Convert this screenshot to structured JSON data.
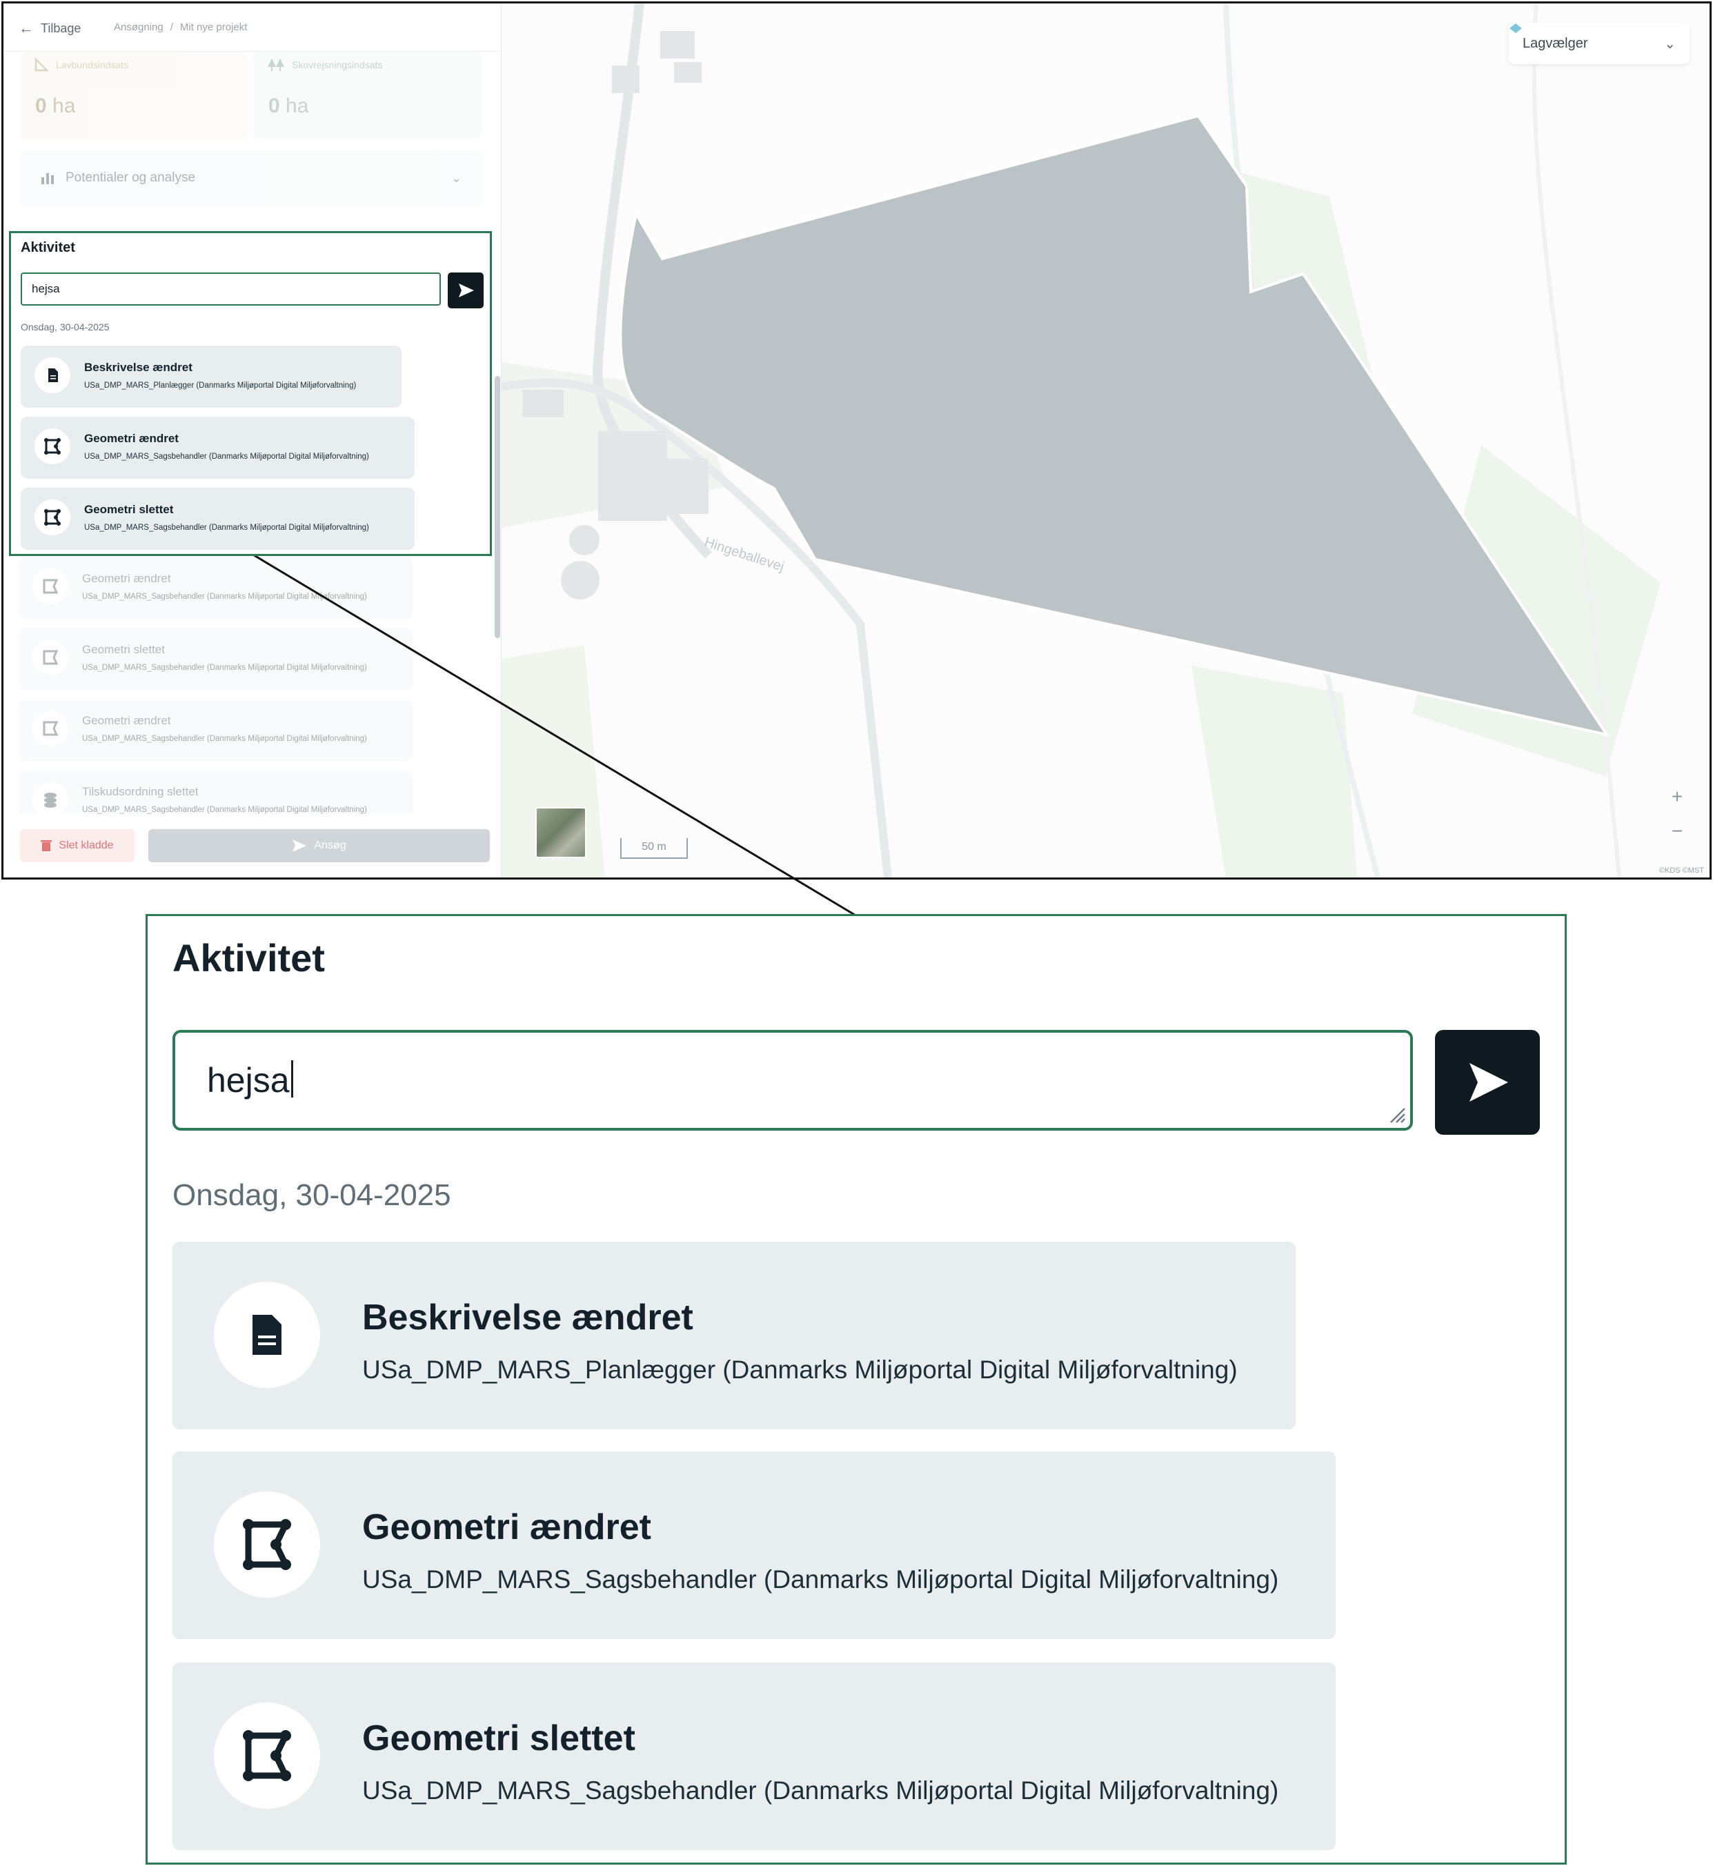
{
  "header": {
    "back_label": "Tilbage",
    "breadcrumb": [
      "Ansøgning",
      "/",
      "Mit nye projekt"
    ]
  },
  "stats": [
    {
      "label": "Lavbundsindsats",
      "value": "0",
      "unit": "ha",
      "icon": "ruler-triangle-icon"
    },
    {
      "label": "Skovrejsningsindsats",
      "value": "0",
      "unit": "ha",
      "icon": "trees-icon"
    }
  ],
  "accordion": {
    "label": "Potentialer og analyse",
    "icon": "bar-chart-icon"
  },
  "activity": {
    "title": "Aktivitet",
    "input_value": "hejsa",
    "date": "Onsdag, 30-04-2025",
    "items": [
      {
        "title": "Beskrivelse ændret",
        "user": "USa_DMP_MARS_Planlægger (Danmarks Miljøportal Digital Miljøforvaltning)",
        "icon": "document-icon"
      },
      {
        "title": "Geometri ændret",
        "user": "USa_DMP_MARS_Sagsbehandler (Danmarks Miljøportal Digital Miljøforvaltning)",
        "icon": "polygon-icon"
      },
      {
        "title": "Geometri slettet",
        "user": "USa_DMP_MARS_Sagsbehandler (Danmarks Miljøportal Digital Miljøforvaltning)",
        "icon": "polygon-icon"
      },
      {
        "title": "Geometri ændret",
        "user": "USa_DMP_MARS_Sagsbehandler (Danmarks Miljøportal Digital Miljøforvaltning)",
        "icon": "polygon-icon"
      },
      {
        "title": "Geometri slettet",
        "user": "USa_DMP_MARS_Sagsbehandler (Danmarks Miljøportal Digital Miljøforvaltning)",
        "icon": "polygon-icon"
      },
      {
        "title": "Geometri ændret",
        "user": "USa_DMP_MARS_Sagsbehandler (Danmarks Miljøportal Digital Miljøforvaltning)",
        "icon": "polygon-icon"
      },
      {
        "title": "Tilskudsordning slettet",
        "user": "USa_DMP_MARS_Sagsbehandler (Danmarks Miljøportal Digital Miljøforvaltning)",
        "icon": "coins-icon"
      }
    ]
  },
  "footer": {
    "delete_label": "Slet kladde",
    "apply_label": "Ansøg"
  },
  "map": {
    "layer_picker_label": "Lagvælger",
    "zoom_in": "+",
    "zoom_out": "−",
    "scale_label": "50 m",
    "road_label": "Hingeballevej",
    "attribution": "©KDS ©MST"
  },
  "colors": {
    "accent": "#2c7a55",
    "send_button": "#0f1a20",
    "card_bg": "#e8edf0",
    "polygon_fill": "#bcc3c6"
  }
}
